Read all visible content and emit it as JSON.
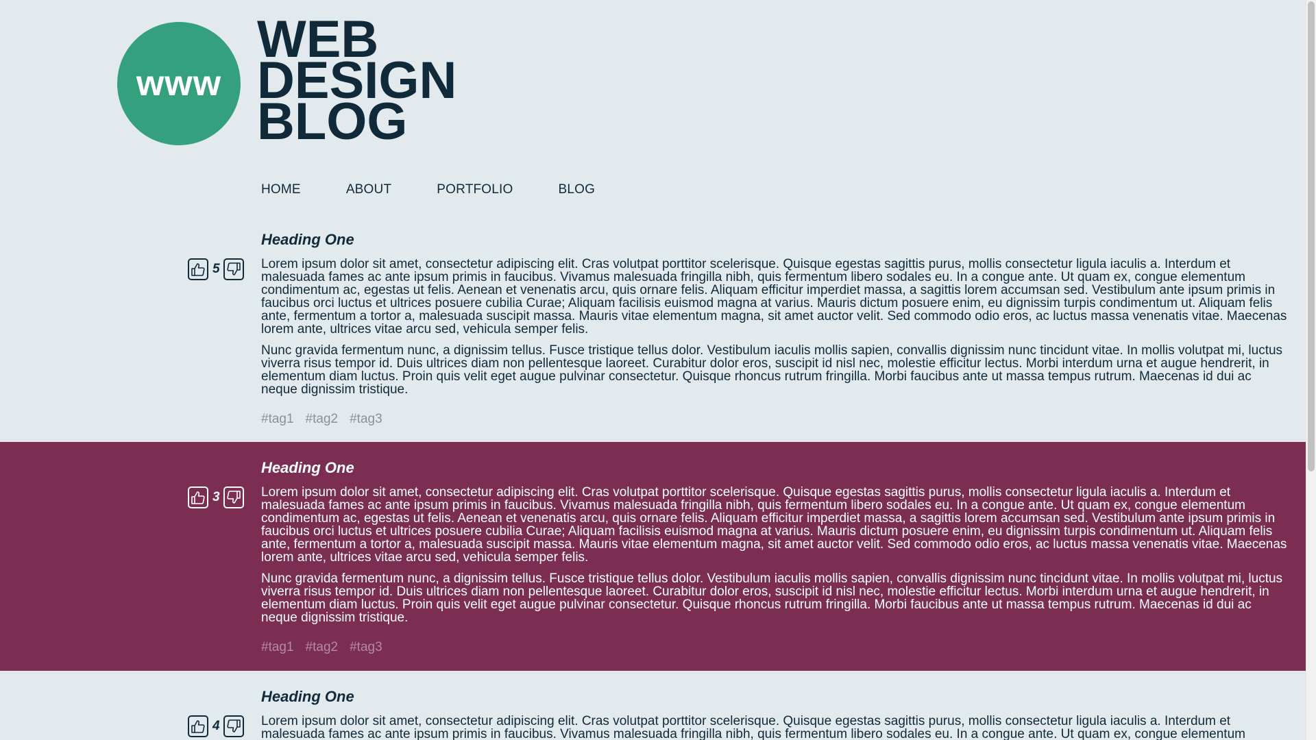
{
  "header": {
    "logo_text": "www",
    "title_lines": [
      "WEB",
      "DESIGN",
      "BLOG"
    ]
  },
  "nav": {
    "items": [
      {
        "label": "HOME"
      },
      {
        "label": "ABOUT"
      },
      {
        "label": "PORTFOLIO"
      },
      {
        "label": "BLOG"
      }
    ]
  },
  "colors": {
    "background": "#e2eaed",
    "logo": "#35a07e",
    "dark_post": "#7b2e52",
    "text": "#112a3a"
  },
  "posts": [
    {
      "heading": "Heading One",
      "votes": "5",
      "paragraphs": [
        "Lorem ipsum dolor sit amet, consectetur adipiscing elit. Cras volutpat porttitor scelerisque. Quisque egestas sagittis purus, mollis consectetur ligula iaculis a. Interdum et malesuada fames ac ante ipsum primis in faucibus. Vivamus malesuada fringilla nibh, quis fermentum libero sodales eu. In a congue ante. Ut quam ex, congue elementum condimentum ac, egestas ut felis. Aenean et venenatis arcu, quis ornare felis. Aliquam efficitur imperdiet massa, a sagittis lorem accumsan sed. Vestibulum ante ipsum primis in faucibus orci luctus et ultrices posuere cubilia Curae; Aliquam facilisis euismod magna at varius. Mauris dictum posuere enim, eu dignissim turpis condimentum ut. Aliquam felis ante, fermentum a tortor a, malesuada suscipit massa. Mauris vitae elementum magna, sit amet auctor velit. Sed commodo odio eros, ac luctus massa venenatis vitae. Maecenas lorem ante, ultrices vitae arcu sed, vehicula semper felis.",
        "Nunc gravida fermentum nunc, a dignissim tellus. Fusce tristique tellus dolor. Vestibulum iaculis mollis sapien, convallis dignissim nunc tincidunt vitae. In mollis volutpat mi, luctus viverra risus tempor id. Duis ultrices diam non pellentesque laoreet. Curabitur dolor eros, suscipit id nisl nec, molestie efficitur lectus. Morbi interdum urna et augue hendrerit, in elementum diam luctus. Proin quis velit eget augue pulvinar consectetur. Quisque rhoncus rutrum fringilla. Morbi faucibus ante ut massa tempus rutrum. Maecenas id dui ac neque dignissim tristique."
      ],
      "tags": [
        "#tag1",
        "#tag2",
        "#tag3"
      ]
    },
    {
      "heading": "Heading One",
      "votes": "3",
      "paragraphs": [
        "Lorem ipsum dolor sit amet, consectetur adipiscing elit. Cras volutpat porttitor scelerisque. Quisque egestas sagittis purus, mollis consectetur ligula iaculis a. Interdum et malesuada fames ac ante ipsum primis in faucibus. Vivamus malesuada fringilla nibh, quis fermentum libero sodales eu. In a congue ante. Ut quam ex, congue elementum condimentum ac, egestas ut felis. Aenean et venenatis arcu, quis ornare felis. Aliquam efficitur imperdiet massa, a sagittis lorem accumsan sed. Vestibulum ante ipsum primis in faucibus orci luctus et ultrices posuere cubilia Curae; Aliquam facilisis euismod magna at varius. Mauris dictum posuere enim, eu dignissim turpis condimentum ut. Aliquam felis ante, fermentum a tortor a, malesuada suscipit massa. Mauris vitae elementum magna, sit amet auctor velit. Sed commodo odio eros, ac luctus massa venenatis vitae. Maecenas lorem ante, ultrices vitae arcu sed, vehicula semper felis.",
        "Nunc gravida fermentum nunc, a dignissim tellus. Fusce tristique tellus dolor. Vestibulum iaculis mollis sapien, convallis dignissim nunc tincidunt vitae. In mollis volutpat mi, luctus viverra risus tempor id. Duis ultrices diam non pellentesque laoreet. Curabitur dolor eros, suscipit id nisl nec, molestie efficitur lectus. Morbi interdum urna et augue hendrerit, in elementum diam luctus. Proin quis velit eget augue pulvinar consectetur. Quisque rhoncus rutrum fringilla. Morbi faucibus ante ut massa tempus rutrum. Maecenas id dui ac neque dignissim tristique."
      ],
      "tags": [
        "#tag1",
        "#tag2",
        "#tag3"
      ]
    },
    {
      "heading": "Heading One",
      "votes": "4",
      "paragraphs": [
        "Lorem ipsum dolor sit amet, consectetur adipiscing elit. Cras volutpat porttitor scelerisque. Quisque egestas sagittis purus, mollis consectetur ligula iaculis a. Interdum et malesuada fames ac ante ipsum primis in faucibus. Vivamus malesuada fringilla nibh, quis fermentum libero sodales eu. In a congue ante. Ut quam ex, congue elementum condimentum ac,"
      ],
      "tags": []
    }
  ]
}
